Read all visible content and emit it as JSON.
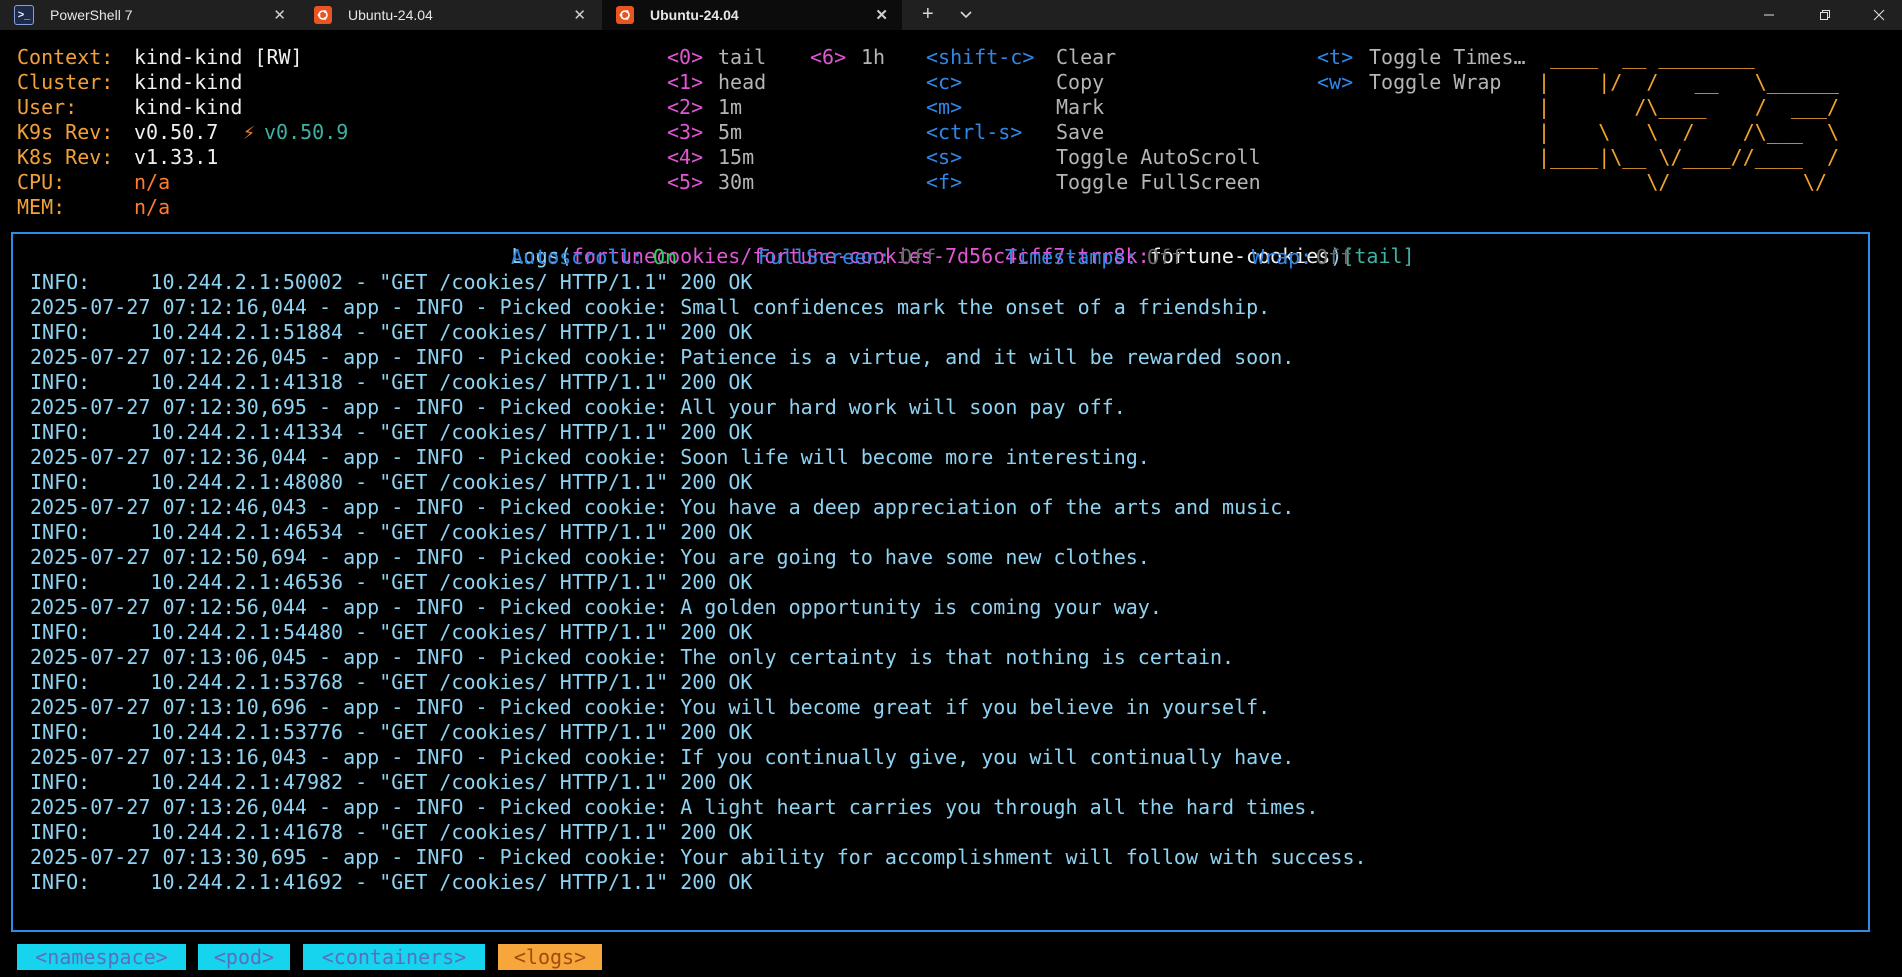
{
  "tabs": [
    {
      "label": "PowerShell 7",
      "icon": "powershell-icon"
    },
    {
      "label": "Ubuntu-24.04",
      "icon": "ubuntu-icon"
    },
    {
      "label": "Ubuntu-24.04",
      "icon": "ubuntu-icon",
      "active": true
    }
  ],
  "info": {
    "context_label": "Context:",
    "context_value": "kind-kind [RW]",
    "cluster_label": "Cluster:",
    "cluster_value": "kind-kind",
    "user_label": "User:",
    "user_value": "kind-kind",
    "k9s_label": "K9s Rev:",
    "k9s_value": "v0.50.7",
    "k9s_update": "v0.50.9",
    "k8s_label": "K8s Rev:",
    "k8s_value": "v1.33.1",
    "cpu_label": "CPU:",
    "cpu_value": "n/a",
    "mem_label": "MEM:",
    "mem_value": "n/a"
  },
  "shortcuts_num": [
    {
      "key": "<0>",
      "label": "tail"
    },
    {
      "key": "<1>",
      "label": "head"
    },
    {
      "key": "<2>",
      "label": "1m"
    },
    {
      "key": "<3>",
      "label": "5m"
    },
    {
      "key": "<4>",
      "label": "15m"
    },
    {
      "key": "<5>",
      "label": "30m"
    },
    {
      "key": "<6>",
      "label": "1h"
    }
  ],
  "shortcuts_actions": [
    {
      "key": "<shift-c>",
      "label": "Clear"
    },
    {
      "key": "<c>",
      "label": "Copy"
    },
    {
      "key": "<m>",
      "label": "Mark"
    },
    {
      "key": "<ctrl-s>",
      "label": "Save"
    },
    {
      "key": "<s>",
      "label": "Toggle AutoScroll"
    },
    {
      "key": "<f>",
      "label": "Toggle FullScreen"
    }
  ],
  "shortcuts_toggles": [
    {
      "key": "<t>",
      "label": "Toggle Times…"
    },
    {
      "key": "<w>",
      "label": "Toggle Wrap"
    }
  ],
  "logo_lines": [
    " ____  __ ________",
    "|    |/  /   __   \\______",
    "|       /\\____    /  ___/",
    "|    \\   \\  /    /\\___  \\",
    "|____|\\__ \\/____//____  /",
    "         \\/           \\/"
  ],
  "logs_title": {
    "prefix": "Logs(",
    "path": "fortunecookies/fortune-cookies-7d56c4cff7-trr8k:",
    "container": "fortune-cookies",
    "close": ")",
    "mode": "[tail]"
  },
  "status": {
    "autoscroll_label": "Autoscroll:",
    "autoscroll_value": "On",
    "fullscreen_label": "FullScreen:",
    "fullscreen_value": "Off",
    "timestamps_label": "Timestamps:",
    "timestamps_value": "Off",
    "wrap_label": "Wrap:",
    "wrap_value": "Off"
  },
  "log_lines": [
    "INFO:     10.244.2.1:50002 - \"GET /cookies/ HTTP/1.1\" 200 OK",
    "2025-07-27 07:12:16,044 - app - INFO - Picked cookie: Small confidences mark the onset of a friendship.",
    "INFO:     10.244.2.1:51884 - \"GET /cookies/ HTTP/1.1\" 200 OK",
    "2025-07-27 07:12:26,045 - app - INFO - Picked cookie: Patience is a virtue, and it will be rewarded soon.",
    "INFO:     10.244.2.1:41318 - \"GET /cookies/ HTTP/1.1\" 200 OK",
    "2025-07-27 07:12:30,695 - app - INFO - Picked cookie: All your hard work will soon pay off.",
    "INFO:     10.244.2.1:41334 - \"GET /cookies/ HTTP/1.1\" 200 OK",
    "2025-07-27 07:12:36,044 - app - INFO - Picked cookie: Soon life will become more interesting.",
    "INFO:     10.244.2.1:48080 - \"GET /cookies/ HTTP/1.1\" 200 OK",
    "2025-07-27 07:12:46,043 - app - INFO - Picked cookie: You have a deep appreciation of the arts and music.",
    "INFO:     10.244.2.1:46534 - \"GET /cookies/ HTTP/1.1\" 200 OK",
    "2025-07-27 07:12:50,694 - app - INFO - Picked cookie: You are going to have some new clothes.",
    "INFO:     10.244.2.1:46536 - \"GET /cookies/ HTTP/1.1\" 200 OK",
    "2025-07-27 07:12:56,044 - app - INFO - Picked cookie: A golden opportunity is coming your way.",
    "INFO:     10.244.2.1:54480 - \"GET /cookies/ HTTP/1.1\" 200 OK",
    "2025-07-27 07:13:06,045 - app - INFO - Picked cookie: The only certainty is that nothing is certain.",
    "INFO:     10.244.2.1:53768 - \"GET /cookies/ HTTP/1.1\" 200 OK",
    "2025-07-27 07:13:10,696 - app - INFO - Picked cookie: You will become great if you believe in yourself.",
    "INFO:     10.244.2.1:53776 - \"GET /cookies/ HTTP/1.1\" 200 OK",
    "2025-07-27 07:13:16,043 - app - INFO - Picked cookie: If you continually give, you will continually have.",
    "INFO:     10.244.2.1:47982 - \"GET /cookies/ HTTP/1.1\" 200 OK",
    "2025-07-27 07:13:26,044 - app - INFO - Picked cookie: A light heart carries you through all the hard times.",
    "INFO:     10.244.2.1:41678 - \"GET /cookies/ HTTP/1.1\" 200 OK",
    "2025-07-27 07:13:30,695 - app - INFO - Picked cookie: Your ability for accomplishment will follow with success.",
    "INFO:     10.244.2.1:41692 - \"GET /cookies/ HTTP/1.1\" 200 OK"
  ],
  "breadcrumbs": [
    "<namespace>",
    "<pod>",
    "<containers>",
    "<logs>"
  ]
}
